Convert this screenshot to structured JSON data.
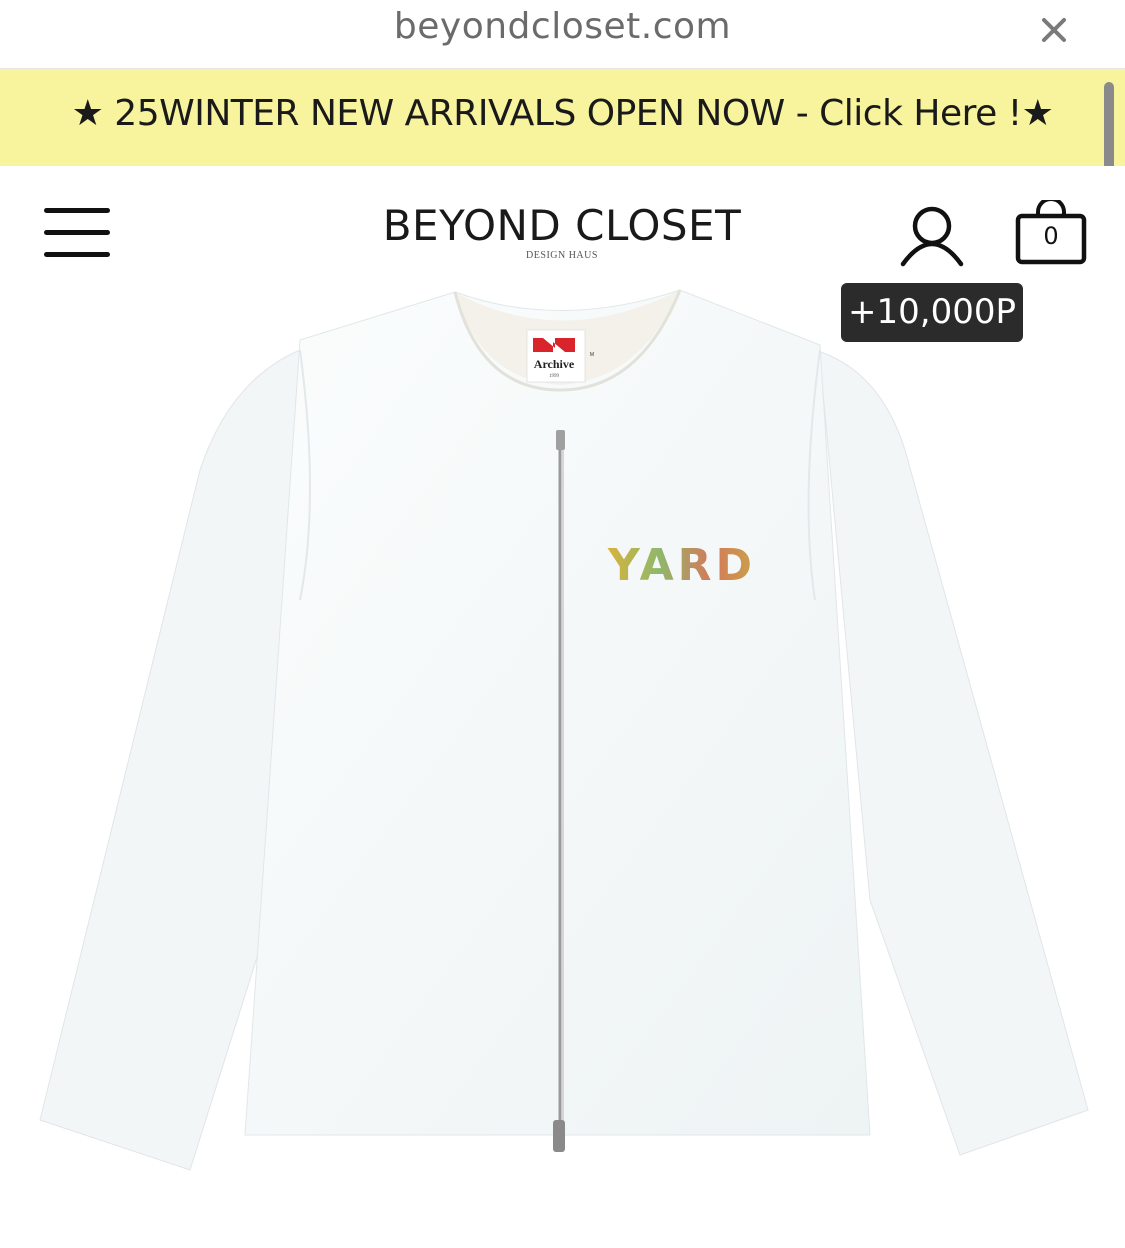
{
  "browser": {
    "url": "beyondcloset.com",
    "close_icon": "close-icon"
  },
  "banner": {
    "text": "★ 25WINTER NEW ARRIVALS OPEN NOW - Click Here !★",
    "background": "#f8f39d"
  },
  "header": {
    "menu_icon": "hamburger-menu-icon",
    "logo_main": "BEYOND CLOSET",
    "logo_sub": "DESIGN HAUS",
    "account_icon": "user-icon",
    "cart_icon": "shopping-bag-icon",
    "cart_count": "0"
  },
  "points_badge": {
    "text": "+10,000P"
  },
  "product": {
    "label_brand": "Archive",
    "label_year": "1999",
    "label_size": "M",
    "print_text": "YARD",
    "colors": {
      "jacket": "#f4f7f8",
      "label_red": "#d9242b"
    }
  }
}
